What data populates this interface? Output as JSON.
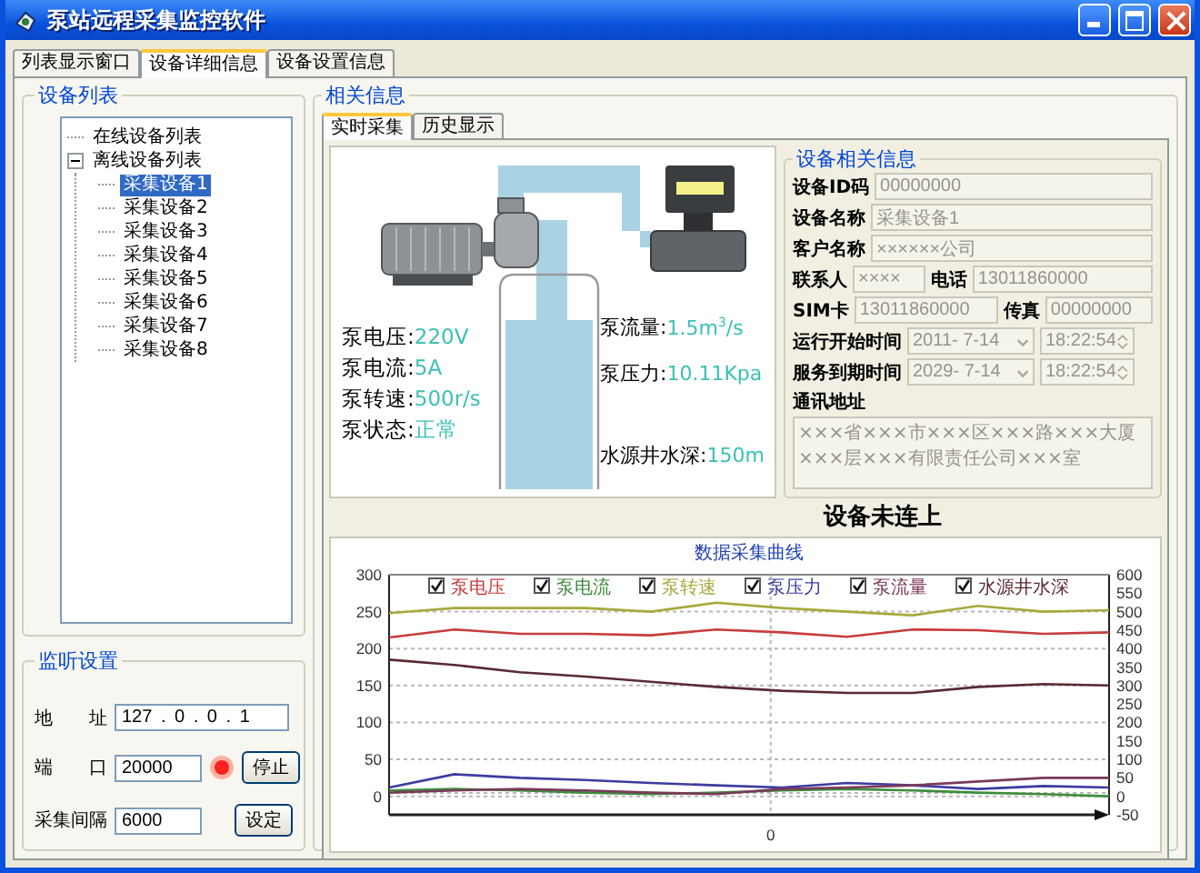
{
  "window": {
    "title": "泵站远程采集监控软件"
  },
  "tabs": [
    {
      "label": "列表显示窗口",
      "selected": false
    },
    {
      "label": "设备详细信息",
      "selected": true
    },
    {
      "label": "设备设置信息",
      "selected": false
    }
  ],
  "device_list": {
    "title": "设备列表",
    "tree": [
      {
        "label": "在线设备列表",
        "selected": false
      },
      {
        "label": "离线设备列表",
        "selected": false,
        "expanded": true,
        "children": [
          {
            "label": "采集设备1",
            "selected": true
          },
          {
            "label": "采集设备2",
            "selected": false
          },
          {
            "label": "采集设备3",
            "selected": false
          },
          {
            "label": "采集设备4",
            "selected": false
          },
          {
            "label": "采集设备5",
            "selected": false
          },
          {
            "label": "采集设备6",
            "selected": false
          },
          {
            "label": "采集设备7",
            "selected": false
          },
          {
            "label": "采集设备8",
            "selected": false
          }
        ]
      }
    ]
  },
  "listen_settings": {
    "title": "监听设置",
    "address": {
      "label": "地 址",
      "value": "127 . 0 . 0 . 1"
    },
    "port": {
      "label": "端 口",
      "value": "20000"
    },
    "listening": true,
    "stop_button": "停止",
    "interval": {
      "label": "采集间隔",
      "value": "6000"
    },
    "set_button": "设定"
  },
  "info": {
    "title": "相关信息",
    "tabs": [
      {
        "label": "实时采集",
        "selected": true
      },
      {
        "label": "历史显示",
        "selected": false
      }
    ],
    "left_readings": [
      {
        "label": "泵电压:",
        "value": "220V"
      },
      {
        "label": "泵电流:",
        "value": "5A"
      },
      {
        "label": "泵转速:",
        "value": "500r/s"
      },
      {
        "label": "泵状态:",
        "value": "正常"
      }
    ],
    "right_readings": [
      {
        "label": "泵流量:",
        "value": "1.5m$^{3}$/s"
      },
      {
        "label": "泵压力:",
        "value": "10.11Kpa"
      },
      {
        "label": "水源井水深:",
        "value": "150m"
      }
    ],
    "device_info": {
      "title": "设备相关信息",
      "rows": [
        {
          "fields": [
            {
              "label": "设备ID码",
              "kind": "text",
              "value": "00000000",
              "disabled": true
            }
          ]
        },
        {
          "fields": [
            {
              "label": "设备名称",
              "kind": "text",
              "value": "采集设备1",
              "disabled": true
            }
          ]
        },
        {
          "fields": [
            {
              "label": "客户名称",
              "kind": "text",
              "value": "××××××公司",
              "disabled": true
            }
          ]
        },
        {
          "fields": [
            {
              "label": "联系人",
              "kind": "text",
              "value": "××××",
              "disabled": true
            },
            {
              "label": "电话",
              "kind": "text",
              "value": "13011860000",
              "disabled": true
            }
          ]
        },
        {
          "fields": [
            {
              "label": "SIM卡",
              "kind": "text",
              "value": "13011860000",
              "disabled": true
            },
            {
              "label": "传真",
              "kind": "text",
              "value": "00000000",
              "disabled": true
            }
          ]
        },
        {
          "fields": [
            {
              "label": "运行开始时间",
              "kind": "date",
              "value": "2011- 7-14",
              "disabled": true
            },
            {
              "kind": "time",
              "value": "18:22:54",
              "disabled": true
            }
          ]
        },
        {
          "fields": [
            {
              "label": "服务到期时间",
              "kind": "date",
              "value": "2029- 7-14",
              "disabled": true
            },
            {
              "kind": "time",
              "value": "18:22:54",
              "disabled": true
            }
          ]
        }
      ],
      "address": {
        "label": "通讯地址",
        "value": "×××省×××市×××区×××路×××大厦×××层×××有限责任公司×××室",
        "disabled": true
      }
    },
    "status": "设备未连上",
    "chart": {
      "right_axis_labels": [
        "600",
        "550",
        "500",
        "450",
        "400",
        "350",
        "300",
        "250",
        "200",
        "150",
        "100",
        "50",
        "0",
        "-50"
      ],
      "legend_checks": [
        {
          "checked": true
        },
        {
          "checked": true
        },
        {
          "checked": true
        },
        {
          "checked": true
        },
        {
          "checked": true
        },
        {
          "checked": true
        }
      ],
      "chart_data": {
        "type": "line",
        "title": "数据采集曲线",
        "grid": true,
        "annotations": [
          {
            "text": "0"
          }
        ],
        "ylim": [
          -25,
          300
        ],
        "yticks": [
          0,
          50,
          100,
          150,
          200,
          250,
          300
        ],
        "series": [
          {
            "name": "泵电压",
            "color": "#c83c3c",
            "values": [
              215,
              226,
              220,
              220,
              218,
              226,
              222,
              216,
              226,
              225,
              220,
              222
            ]
          },
          {
            "name": "泵电流",
            "color": "#3c8c3c",
            "values": [
              8,
              10,
              8,
              5,
              3,
              5,
              8,
              10,
              8,
              5,
              3,
              0
            ]
          },
          {
            "name": "泵转速",
            "color": "#a8a83c",
            "values": [
              248,
              255,
              255,
              255,
              250,
              262,
              255,
              250,
              245,
              258,
              250,
              252
            ]
          },
          {
            "name": "泵压力",
            "color": "#3c3ca0",
            "values": [
              12,
              30,
              25,
              22,
              18,
              15,
              12,
              18,
              15,
              10,
              14,
              12
            ]
          },
          {
            "name": "泵流量",
            "color": "#7a3a5a",
            "values": [
              5,
              8,
              10,
              8,
              5,
              3,
              10,
              12,
              15,
              20,
              25,
              25
            ]
          },
          {
            "name": "水源井水深",
            "color": "#5a2a32",
            "values": [
              185,
              178,
              168,
              162,
              155,
              148,
              143,
              140,
              140,
              148,
              152,
              150
            ]
          }
        ]
      }
    }
  }
}
